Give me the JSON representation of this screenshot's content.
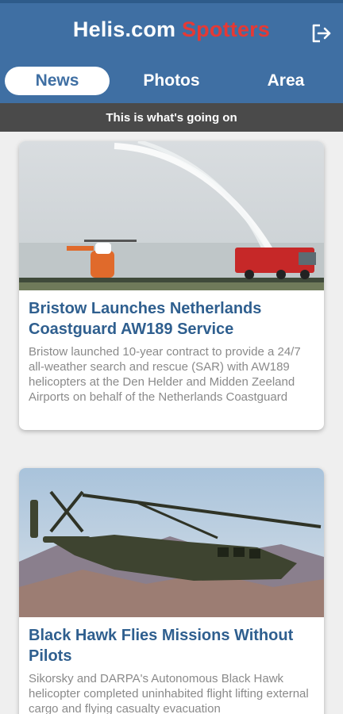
{
  "header": {
    "brand": "Helis.com",
    "accent": "Spotters",
    "logout_icon": "logout-icon",
    "colors": {
      "bar": "#3f6fa3",
      "accent": "#e53935"
    }
  },
  "tabs": [
    {
      "label": "News",
      "active": true
    },
    {
      "label": "Photos",
      "active": false
    },
    {
      "label": "Area",
      "active": false
    }
  ],
  "subheader": "This is what's going on",
  "articles": [
    {
      "title": "Bristow Launches Netherlands Coastguard AW189 Service",
      "description": "Bristow launched 10-year contract to provide a 24/7 all-weather search and rescue (SAR) with AW189 helicopters at the Den Helder and Midden Zeeland Airports on behalf of the Netherlands Coastguard"
    },
    {
      "title": "Black Hawk Flies Missions Without Pilots",
      "description": "Sikorsky and DARPA's Autonomous Black Hawk helicopter completed uninhabited    flight lifting external cargo and flying casualty evacuation"
    }
  ]
}
